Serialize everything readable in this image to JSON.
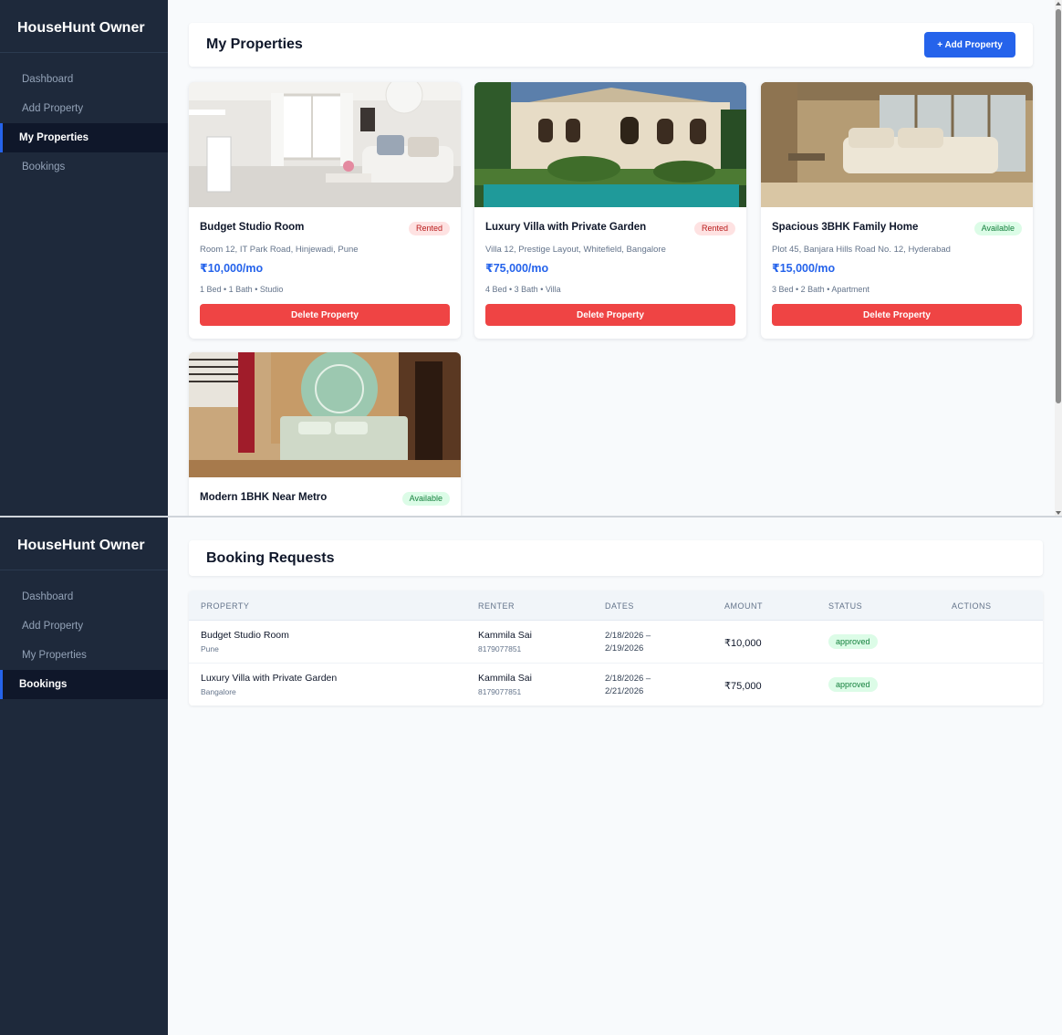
{
  "app": {
    "brand": "HouseHunt Owner"
  },
  "nav": {
    "dashboard": "Dashboard",
    "add_property": "Add Property",
    "my_properties": "My Properties",
    "bookings": "Bookings"
  },
  "properties_page": {
    "title": "My Properties",
    "add_button": "+ Add Property",
    "delete_label": "Delete Property",
    "cards": [
      {
        "title": "Budget Studio Room",
        "status": "Rented",
        "address": "Room 12, IT Park Road, Hinjewadi, Pune",
        "price": "₹10,000/mo",
        "meta": "1 Bed  •  1 Bath  •  Studio"
      },
      {
        "title": "Luxury Villa with Private Garden",
        "status": "Rented",
        "address": "Villa 12, Prestige Layout, Whitefield, Bangalore",
        "price": "₹75,000/mo",
        "meta": "4 Bed  •  3 Bath  •  Villa"
      },
      {
        "title": "Spacious 3BHK Family Home",
        "status": "Available",
        "address": "Plot 45, Banjara Hills Road No. 12, Hyderabad",
        "price": "₹15,000/mo",
        "meta": "3 Bed  •  2 Bath  •  Apartment"
      },
      {
        "title": "Modern 1BHK Near Metro",
        "status": "Available"
      }
    ]
  },
  "bookings_page": {
    "title": "Booking Requests",
    "columns": [
      "PROPERTY",
      "RENTER",
      "DATES",
      "AMOUNT",
      "STATUS",
      "ACTIONS"
    ],
    "rows": [
      {
        "property": "Budget Studio Room",
        "city": "Pune",
        "renter": "Kammila Sai",
        "phone": "8179077851",
        "date_from": "2/18/2026 –",
        "date_to": "2/19/2026",
        "amount": "₹10,000",
        "status": "approved"
      },
      {
        "property": "Luxury Villa with Private Garden",
        "city": "Bangalore",
        "renter": "Kammila Sai",
        "phone": "8179077851",
        "date_from": "2/18/2026 –",
        "date_to": "2/21/2026",
        "amount": "₹75,000",
        "status": "approved"
      }
    ]
  },
  "colors": {
    "sidebar": "#1e293b",
    "accent": "#2563eb",
    "danger": "#ef4444",
    "rented": "#b91c1c",
    "available": "#15803d"
  }
}
